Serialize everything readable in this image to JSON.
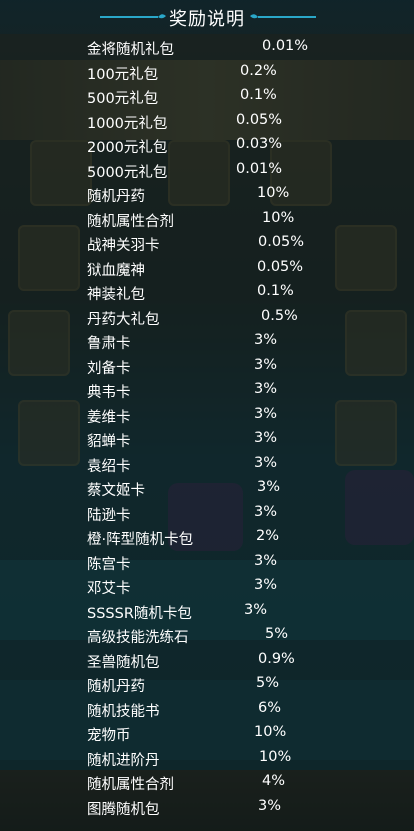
{
  "title": "奖励说明",
  "colors": {
    "accent": "#2aa7c8",
    "text": "#ffffff",
    "panel": "#102428"
  },
  "rewards": [
    {
      "name": "金将随机礼包",
      "pct": "0.01%"
    },
    {
      "name": "100元礼包",
      "pct": "0.2%"
    },
    {
      "name": "500元礼包",
      "pct": "0.1%"
    },
    {
      "name": "1000元礼包",
      "pct": "0.05%"
    },
    {
      "name": "2000元礼包",
      "pct": "0.03%"
    },
    {
      "name": "5000元礼包",
      "pct": "0.01%"
    },
    {
      "name": "随机丹药",
      "pct": "10%"
    },
    {
      "name": "随机属性合剂",
      "pct": "10%"
    },
    {
      "name": "战神关羽卡",
      "pct": "0.05%"
    },
    {
      "name": "狱血魔神",
      "pct": "0.05%"
    },
    {
      "name": "神装礼包",
      "pct": "0.1%"
    },
    {
      "name": "丹药大礼包",
      "pct": "0.5%"
    },
    {
      "name": "鲁肃卡",
      "pct": "3%"
    },
    {
      "name": "刘备卡",
      "pct": "3%"
    },
    {
      "name": "典韦卡",
      "pct": "3%"
    },
    {
      "name": "姜维卡",
      "pct": "3%"
    },
    {
      "name": "貂蝉卡",
      "pct": "3%"
    },
    {
      "name": "袁绍卡",
      "pct": "3%"
    },
    {
      "name": "蔡文姬卡",
      "pct": "3%"
    },
    {
      "name": "陆逊卡",
      "pct": "3%"
    },
    {
      "name": "橙·阵型随机卡包",
      "pct": "2%"
    },
    {
      "name": "陈宫卡",
      "pct": "3%"
    },
    {
      "name": "邓艾卡",
      "pct": "3%"
    },
    {
      "name": "SSSSR随机卡包",
      "pct": "3%"
    },
    {
      "name": "高级技能洗练石",
      "pct": "5%"
    },
    {
      "name": "圣兽随机包",
      "pct": "0.9%"
    },
    {
      "name": "随机丹药",
      "pct": "5%"
    },
    {
      "name": "随机技能书",
      "pct": "6%"
    },
    {
      "name": "宠物币",
      "pct": "10%"
    },
    {
      "name": "随机进阶丹",
      "pct": "10%"
    },
    {
      "name": "随机属性合剂",
      "pct": "4%"
    },
    {
      "name": "图腾随机包",
      "pct": "3%"
    }
  ]
}
